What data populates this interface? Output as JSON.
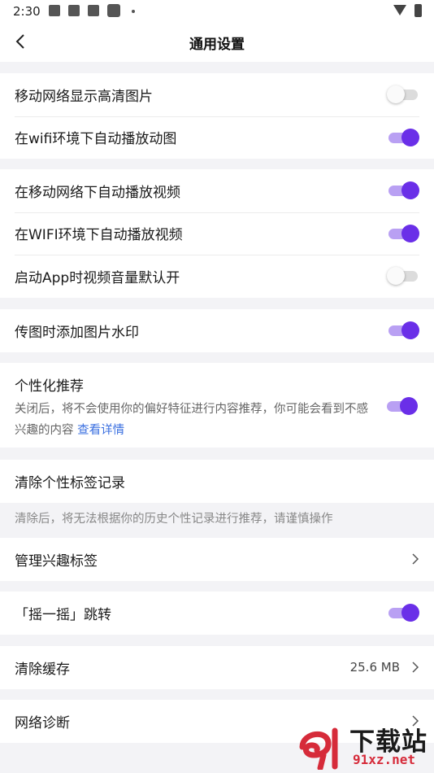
{
  "status_bar": {
    "time": "2:30",
    "icons": [
      "notification-square-icon",
      "notification-square-icon",
      "notification-square-icon",
      "notification-square-icon",
      "dot-icon",
      "wifi-icon",
      "battery-icon"
    ]
  },
  "nav": {
    "title": "通用设置",
    "back_icon": "chevron-left-icon"
  },
  "groups": {
    "g1": [
      {
        "label": "移动网络显示高清图片",
        "toggle": false
      },
      {
        "label": "在wifi环境下自动播放动图",
        "toggle": true
      }
    ],
    "g2": [
      {
        "label": "在移动网络下自动播放视频",
        "toggle": true
      },
      {
        "label": "在WIFI环境下自动播放视频",
        "toggle": true
      },
      {
        "label": "启动App时视频音量默认开",
        "toggle": false
      }
    ],
    "g3": [
      {
        "label": "传图时添加图片水印",
        "toggle": true
      }
    ],
    "recommend": {
      "title": "个性化推荐",
      "desc": "关闭后，将不会使用你的偏好特征进行内容推荐，你可能会看到不感兴趣的内容",
      "link": "查看详情",
      "toggle": true
    },
    "clear_tags": {
      "label": "清除个性标签记录"
    },
    "clear_tags_tip": "清除后，将无法根据你的历史个性记录进行推荐，请谨慎操作",
    "interest": {
      "label": "管理兴趣标签"
    },
    "shake": {
      "label": "「摇一摇」跳转",
      "toggle": true
    },
    "cache": {
      "label": "清除缓存",
      "value": "25.6 MB"
    },
    "network": {
      "label": "网络诊断"
    }
  },
  "watermark": {
    "logo": "91-logo",
    "big_text": "下载站",
    "small_text": "91xz.net"
  },
  "colors": {
    "accent": "#6a2fe8",
    "accent_track": "#b9a0f3",
    "link": "#3a6fe0",
    "background": "#f3f3f6"
  }
}
